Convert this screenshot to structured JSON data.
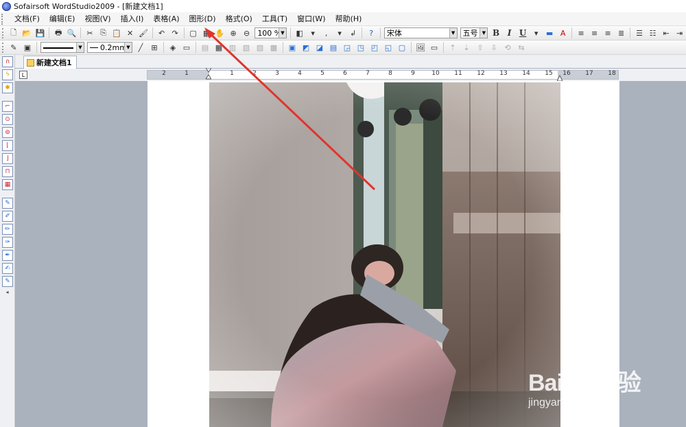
{
  "window": {
    "title": "Sofairsoft WordStudio2009 - [新建文档1]"
  },
  "menu": [
    "文档(F)",
    "编辑(E)",
    "视图(V)",
    "插入(I)",
    "表格(A)",
    "图形(D)",
    "格式(O)",
    "工具(T)",
    "窗口(W)",
    "帮助(H)"
  ],
  "toolbar1": {
    "zoom": "100 %",
    "font_name": "宋体",
    "font_size": "五号",
    "bold": "B",
    "italic": "I",
    "underline": "U"
  },
  "toolbar2": {
    "line_width": "0.2mm"
  },
  "tab": {
    "label": "新建文档1"
  },
  "ruler": {
    "ticks": [
      "2",
      "1",
      "1",
      "2",
      "3",
      "4",
      "5",
      "6",
      "7",
      "8",
      "9",
      "10",
      "11",
      "12",
      "13",
      "14",
      "15",
      "16",
      "17",
      "18"
    ]
  },
  "watermark": {
    "brand": "Baidu 经验",
    "url": "jingyan.baidu.com"
  },
  "colors": {
    "arrow": "#e0342c",
    "workspace": "#a9b2bd",
    "page": "#ffffff"
  }
}
